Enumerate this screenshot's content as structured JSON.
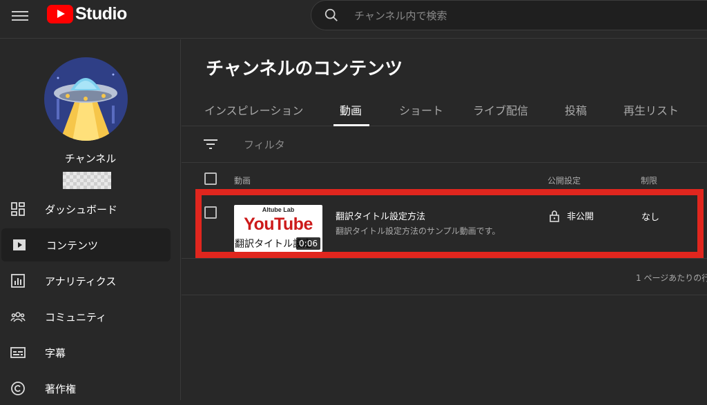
{
  "header": {
    "app_name": "Studio",
    "search_placeholder": "チャンネル内で検索"
  },
  "sidebar": {
    "channel_name": "チャンネル",
    "items": [
      {
        "label": "ダッシュボード",
        "icon": "dashboard-icon"
      },
      {
        "label": "コンテンツ",
        "icon": "content-icon",
        "active": true
      },
      {
        "label": "アナリティクス",
        "icon": "analytics-icon"
      },
      {
        "label": "コミュニティ",
        "icon": "community-icon"
      },
      {
        "label": "字幕",
        "icon": "subtitles-icon"
      },
      {
        "label": "著作権",
        "icon": "copyright-icon"
      }
    ]
  },
  "main": {
    "title": "チャンネルのコンテンツ",
    "tabs": [
      {
        "label": "インスピレーション"
      },
      {
        "label": "動画",
        "active": true
      },
      {
        "label": "ショート"
      },
      {
        "label": "ライブ配信"
      },
      {
        "label": "投稿"
      },
      {
        "label": "再生リスト"
      }
    ],
    "filter_label": "フィルタ",
    "columns": {
      "video": "動画",
      "visibility": "公開設定",
      "restrictions": "制限"
    },
    "rows": [
      {
        "thumb_top": "Altube Lab",
        "thumb_brand": "YouTube",
        "thumb_text": "翻訳タイトル設定",
        "duration": "0:06",
        "title": "翻訳タイトル設定方法",
        "description": "翻訳タイトル設定方法のサンプル動画です。",
        "visibility": "非公開",
        "restrictions": "なし"
      }
    ],
    "pager_text": "1 ページあたりの行"
  },
  "colors": {
    "background": "#282828",
    "highlight": "#e0261e",
    "brand_red": "#ff0000"
  }
}
